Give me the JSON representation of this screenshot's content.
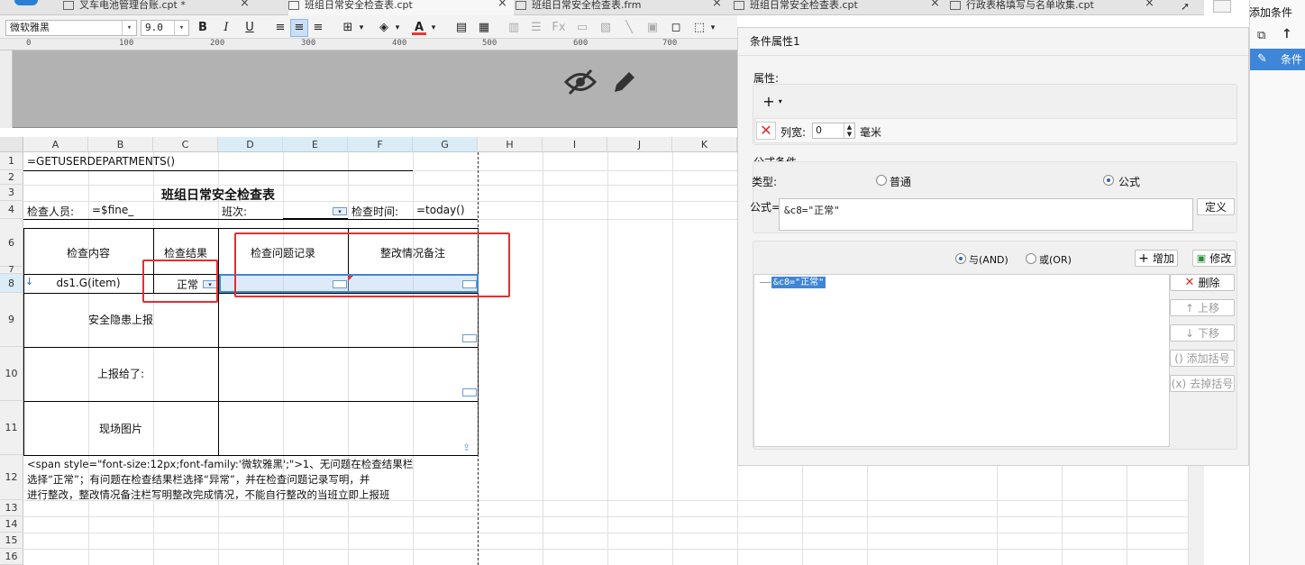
{
  "tabs": [
    {
      "label": "叉车电池管理台账.cpt *"
    },
    {
      "label": "班组日常安全检查表.cpt"
    },
    {
      "label": "班组日常安全检查表.frm"
    },
    {
      "label": "班组日常安全检查表.cpt"
    },
    {
      "label": "行政表格填写与名单收集.cpt"
    }
  ],
  "toolbar": {
    "font_family": "微软雅黑",
    "font_size": "9.0",
    "bold": "B",
    "italic": "I",
    "underline": "U",
    "font_color": "#e53935"
  },
  "ruler_ticks": [
    "0",
    "100",
    "200",
    "300",
    "400",
    "500",
    "600",
    "700"
  ],
  "columns": [
    "A",
    "B",
    "C",
    "D",
    "E",
    "F",
    "G",
    "H",
    "I",
    "J",
    "K"
  ],
  "rows": [
    "1",
    "2",
    "3",
    "4",
    "6",
    "7",
    "8",
    "9",
    "10",
    "11",
    "12",
    "13",
    "14",
    "15",
    "16"
  ],
  "sheet": {
    "formula_dept": "=GETUSERDEPARTMENTS()",
    "title": "班组日常安全检查表",
    "inspector_label": "检查人员:",
    "inspector_value": "=$fine_",
    "shift_label": "班次:",
    "time_label": "检查时间:",
    "time_value": "=today()",
    "hdr_content": "检查内容",
    "hdr_result": "检查结果",
    "hdr_record": "检查问题记录",
    "hdr_remark": "整改情况备注",
    "ds_item": "ds1.G(item)",
    "result_value": "正常",
    "hazard": "安全隐患上报",
    "report_to": "上报给了:",
    "photo": "现场图片",
    "note_line1": "<span style=\"font-size:12px;font-family:'微软雅黑';\">1、无问题在检查结果栏",
    "note_line2": "选择“正常”；有问题在检查结果栏选择“异常”，并在检查问题记录写明，并",
    "note_line3": "进行整改，整改情况备注栏写明整改完成情况，不能自行整改的当班立即上报班"
  },
  "panel": {
    "title": "条件属性1",
    "attr_label": "属性:",
    "col_width_label": "列宽:",
    "col_width_value": "0",
    "unit": "毫米",
    "formula_section": "公式条件",
    "type_label": "类型:",
    "type_normal": "普通",
    "type_formula": "公式",
    "formula_label": "公式=",
    "formula_value": "&c8=\"正常\"",
    "define_button": "定义",
    "and_label": "与(AND)",
    "or_label": "或(OR)",
    "add_button": "增加",
    "modify_button": "修改",
    "condition_item": "&c8=\"正常\"",
    "delete_button": "删除",
    "up_button": "上移",
    "down_button": "下移",
    "add_paren_button": "添加括号",
    "remove_paren_button": "去掉括号"
  },
  "right_sidebar": {
    "title": "添加条件",
    "item_label": "条件"
  }
}
